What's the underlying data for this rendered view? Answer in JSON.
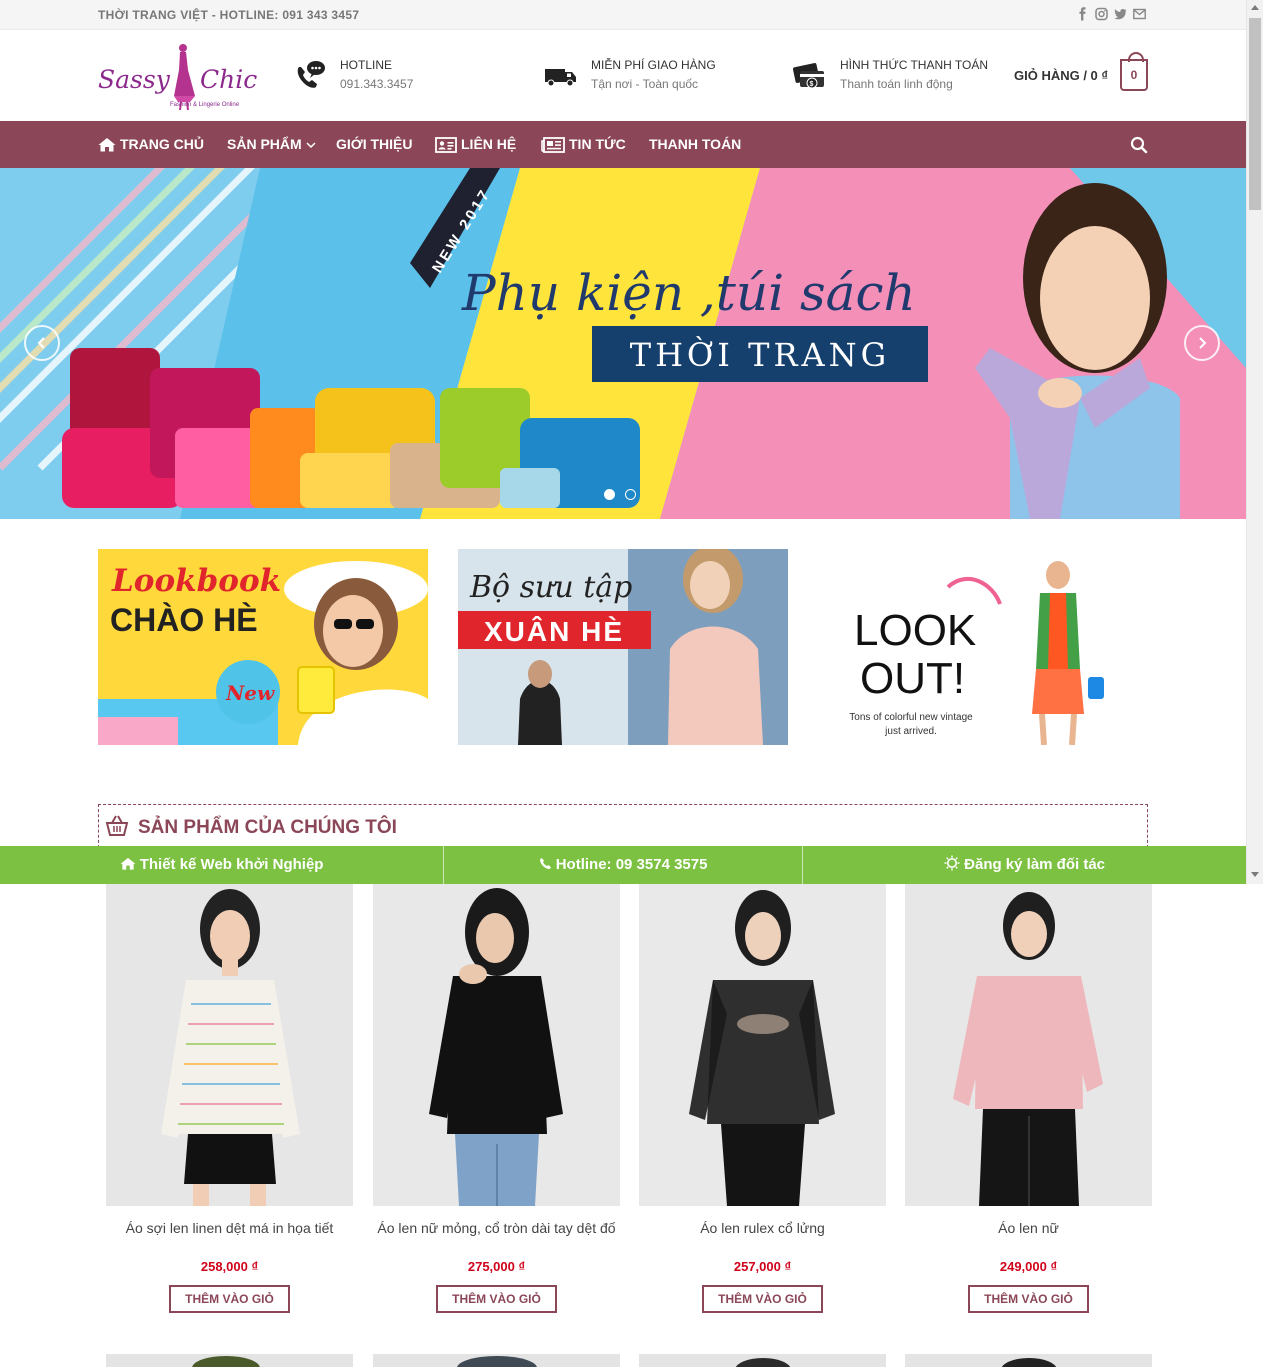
{
  "topbar": {
    "text": "THỜI TRANG VIỆT - HOTLINE: 091 343 3457",
    "social_icons": [
      "facebook-icon",
      "instagram-icon",
      "twitter-icon",
      "email-icon"
    ]
  },
  "logo": {
    "name": "Sassy Chic",
    "tagline": "Fashion & Lingerie Online",
    "color": "#8b2a8c"
  },
  "header": {
    "hotline": {
      "title": "HOTLINE",
      "sub": "091.343.3457",
      "icon": "phone-icon"
    },
    "shipping": {
      "title": "MIỄN PHÍ GIAO HÀNG",
      "sub": "Tận nơi - Toàn quốc",
      "icon": "truck-icon"
    },
    "payment": {
      "title": "HÌNH THỨC THANH TOÁN",
      "sub": "Thanh toán linh động",
      "icon": "payment-icon"
    },
    "cart": {
      "label": "GIỎ HÀNG / 0 ₫",
      "count": "0"
    }
  },
  "nav": {
    "items": [
      {
        "label": "TRANG CHỦ",
        "icon": "home-icon"
      },
      {
        "label": "SẢN PHẨM",
        "icon": "chevron-down-icon"
      },
      {
        "label": "GIỚI THIỆU",
        "icon": ""
      },
      {
        "label": "LIÊN HỆ",
        "icon": "contact-card-icon"
      },
      {
        "label": "TIN TỨC",
        "icon": "newspaper-icon"
      },
      {
        "label": "THANH TOÁN",
        "icon": ""
      }
    ],
    "search_icon": "search-icon"
  },
  "hero": {
    "badge": "NEW 2017",
    "headline": "Phụ kiện ,túi sách",
    "subheadline": "THỜI TRANG",
    "slides": 2,
    "active_slide": 1
  },
  "banners": [
    {
      "line1": "Lookbook",
      "line2": "CHÀO HÈ",
      "badge": "New"
    },
    {
      "line1": "Bộ sưu tập",
      "line2": "XUÂN HÈ"
    },
    {
      "line1": "LOOK",
      "line2": "OUT!",
      "line3": "Tons of colorful new vintage",
      "line4": "just arrived."
    }
  ],
  "section": {
    "title": "SẢN PHẨM CỦA CHÚNG TÔI",
    "icon": "basket-icon"
  },
  "greenbar": {
    "items": [
      {
        "label": "Thiết kế Web khởi Nghiệp",
        "icon": "home-icon"
      },
      {
        "label": "Hotline: 09 3574 3575",
        "icon": "phone-icon"
      },
      {
        "label": "Đăng ký làm đối tác",
        "icon": "sun-icon"
      }
    ],
    "color": "#7cc142"
  },
  "products": [
    {
      "name": "Áo sợi len linen dệt má in họa tiết",
      "price": "258,000 ₫",
      "button": "THÊM VÀO GIỎ"
    },
    {
      "name": "Áo len nữ mỏng, cổ tròn dài tay dệt đố",
      "price": "275,000 ₫",
      "button": "THÊM VÀO GIỎ"
    },
    {
      "name": "Áo len rulex cổ lửng",
      "price": "257,000 ₫",
      "button": "THÊM VÀO GIỎ"
    },
    {
      "name": "Áo len nữ",
      "price": "249,000 ₫",
      "button": "THÊM VÀO GIỎ"
    }
  ],
  "colors": {
    "brand": "#8b4757",
    "price": "#d0021b",
    "green": "#7cc142"
  }
}
